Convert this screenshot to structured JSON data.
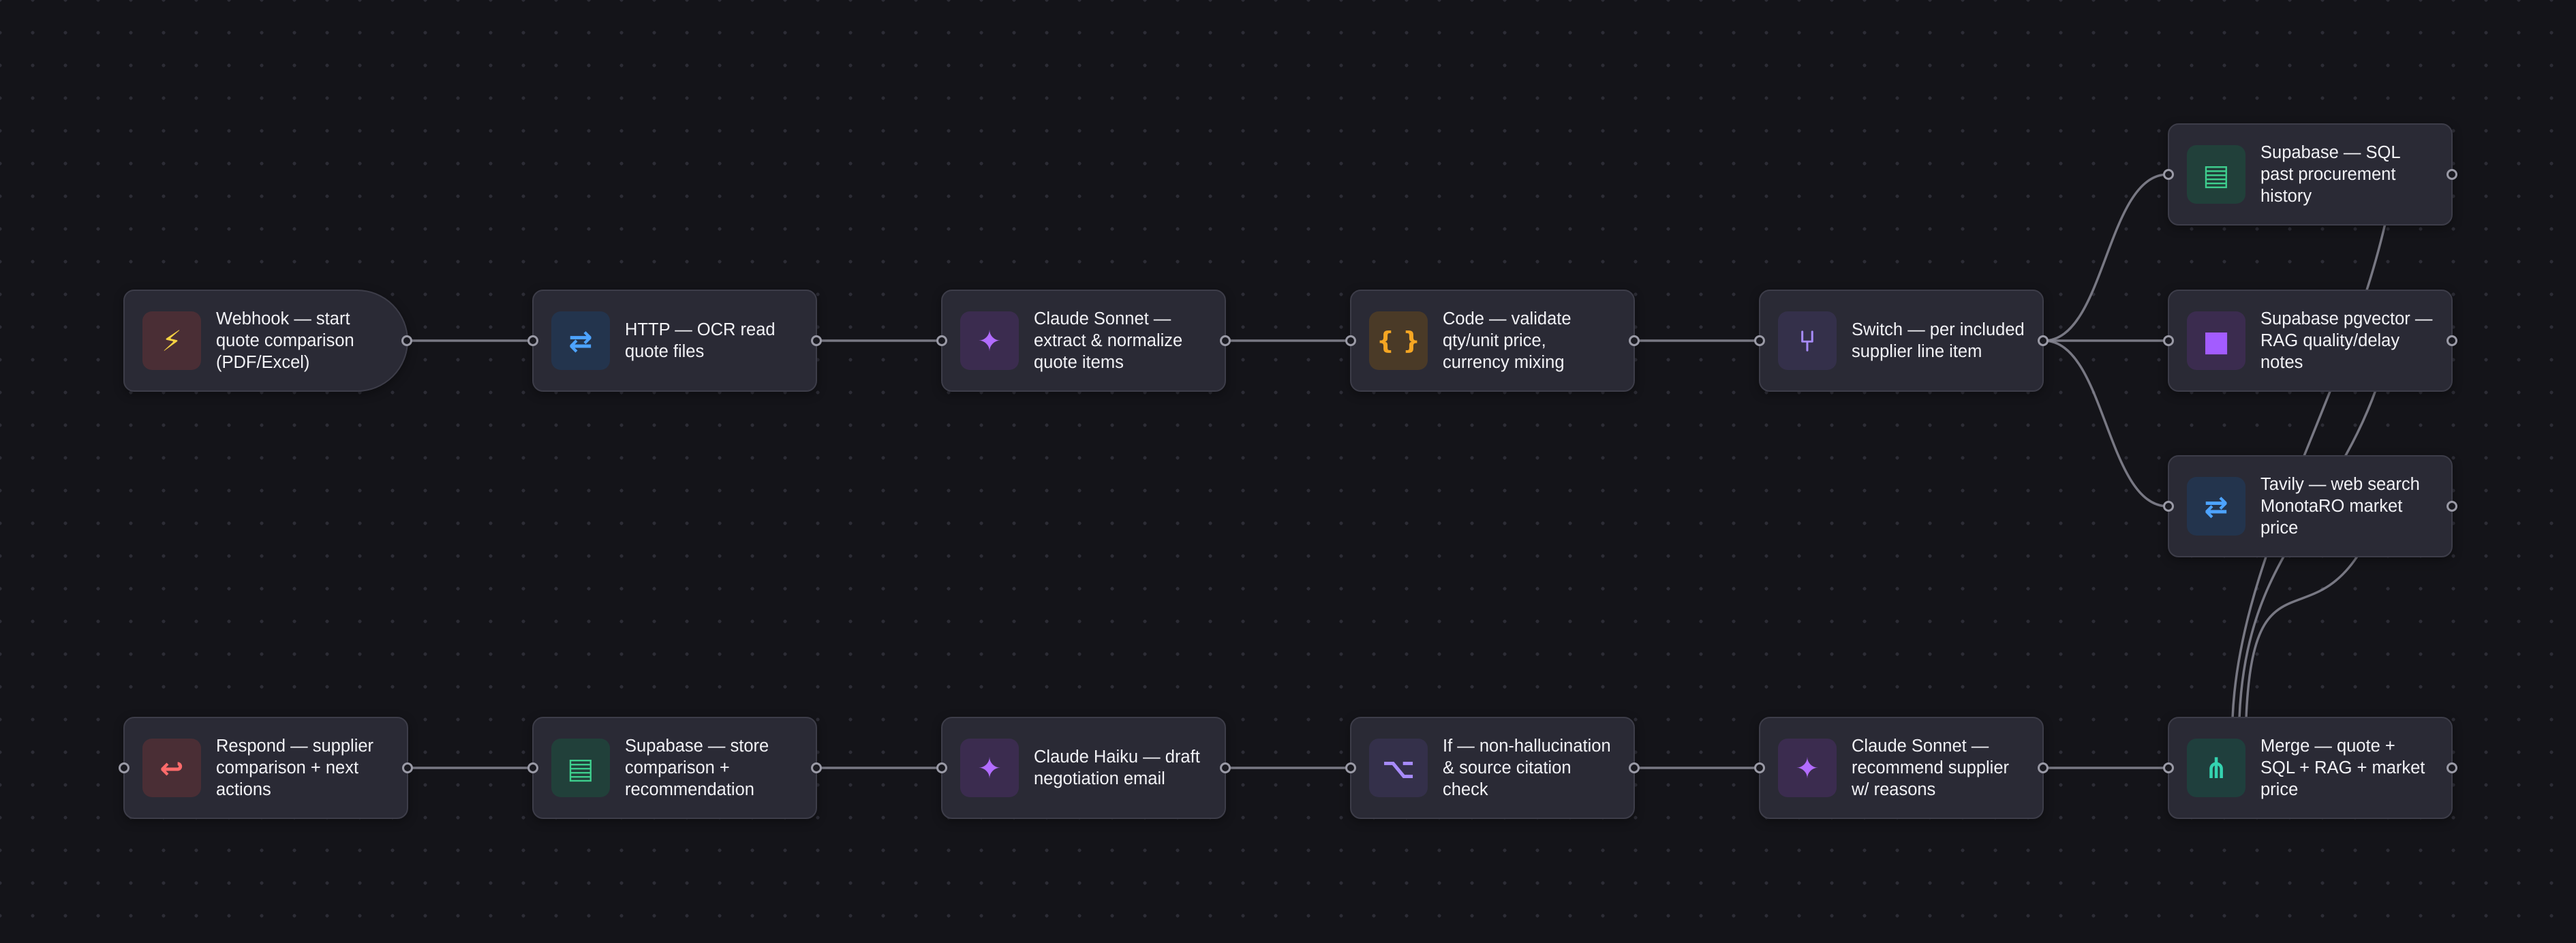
{
  "nodes": [
    {
      "id": "webhook",
      "label": "Webhook — start quote comparison (PDF/Excel)",
      "icon": "lightning-icon",
      "glyph": "⚡",
      "color": "#f5d142",
      "bg": "#4a2e35",
      "in": false,
      "out": true
    },
    {
      "id": "http-ocr",
      "label": "HTTP — OCR read quote files",
      "icon": "transfer-arrows-icon",
      "glyph": "⇄",
      "color": "#4da3ff",
      "bg": "#23344d",
      "in": true,
      "out": true
    },
    {
      "id": "claude-extract",
      "label": "Claude Sonnet — extract & normalize quote items",
      "icon": "sparkle-icon",
      "glyph": "✦",
      "color": "#b26cff",
      "bg": "#3b2c4f",
      "in": true,
      "out": true
    },
    {
      "id": "code-validate",
      "label": "Code — validate qty/unit price, currency mixing",
      "icon": "braces-icon",
      "glyph": "{ }",
      "color": "#f5a623",
      "bg": "#4a3a27",
      "in": true,
      "out": true
    },
    {
      "id": "switch",
      "label": "Switch — per included supplier line item",
      "icon": "fork-icon",
      "glyph": "⑂",
      "color": "#a78bfa",
      "bg": "#34304a",
      "in": true,
      "out": true
    },
    {
      "id": "supabase-sql",
      "label": "Supabase — SQL past procurement history",
      "icon": "database-icon",
      "glyph": "▤",
      "color": "#3ecf8e",
      "bg": "#21403a",
      "in": true,
      "out": true
    },
    {
      "id": "pgvector",
      "label": "Supabase pgvector — RAG quality/delay notes",
      "icon": "vector-store-icon",
      "glyph": "■",
      "color": "#a35cff",
      "bg": "#3b2c4f",
      "in": true,
      "out": true
    },
    {
      "id": "tavily",
      "label": "Tavily — web search MonotaRO market price",
      "icon": "transfer-arrows-icon",
      "glyph": "⇄",
      "color": "#4da3ff",
      "bg": "#23344d",
      "in": true,
      "out": true
    },
    {
      "id": "merge",
      "label": "Merge — quote + SQL + RAG + market price",
      "icon": "merge-icon",
      "glyph": "⋔",
      "color": "#34d3b0",
      "bg": "#1f3f3d",
      "in": true,
      "out": true
    },
    {
      "id": "claude-recommend",
      "label": "Claude Sonnet — recommend supplier w/ reasons",
      "icon": "sparkle-icon",
      "glyph": "✦",
      "color": "#b26cff",
      "bg": "#3b2c4f",
      "in": true,
      "out": true
    },
    {
      "id": "if-check",
      "label": "If — non-hallucination & source citation check",
      "icon": "branch-icon",
      "glyph": "⌥",
      "color": "#a78bfa",
      "bg": "#34304a",
      "in": true,
      "out": true
    },
    {
      "id": "claude-haiku",
      "label": "Claude Haiku — draft negotiation email",
      "icon": "sparkle-icon",
      "glyph": "✦",
      "color": "#b26cff",
      "bg": "#3b2c4f",
      "in": true,
      "out": true
    },
    {
      "id": "supabase-store",
      "label": "Supabase — store comparison + recommendation",
      "icon": "database-icon",
      "glyph": "▤",
      "color": "#3ecf8e",
      "bg": "#21403a",
      "in": true,
      "out": true
    },
    {
      "id": "respond",
      "label": "Respond — supplier comparison + next actions",
      "icon": "return-arrow-icon",
      "glyph": "↩",
      "color": "#ff6b6b",
      "bg": "#4a2e35",
      "in": true,
      "out": true
    }
  ],
  "colors": {
    "edge": "#8a8a96",
    "node_bg": "#2a2a35",
    "node_border": "#3d3d49"
  }
}
